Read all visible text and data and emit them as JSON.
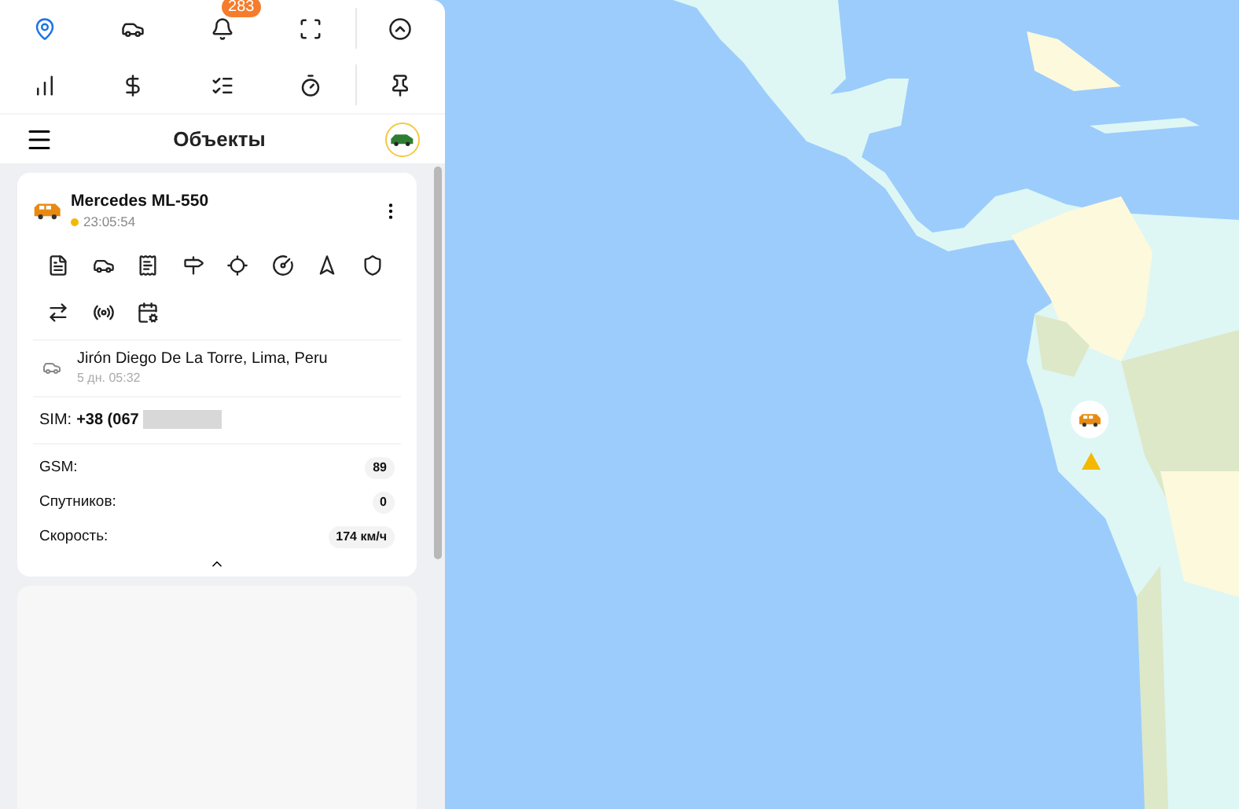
{
  "toolbar": {
    "rows": [
      [
        {
          "kind": "pin",
          "selected": true
        },
        {
          "kind": "car",
          "selected": false
        },
        {
          "kind": "bell",
          "selected": false,
          "badge": "283"
        },
        {
          "kind": "frame",
          "selected": false
        },
        {
          "kind": "collapse",
          "selected": false
        }
      ],
      [
        {
          "kind": "chart",
          "selected": false
        },
        {
          "kind": "dollar",
          "selected": false
        },
        {
          "kind": "list",
          "selected": false
        },
        {
          "kind": "clock",
          "selected": false
        },
        {
          "kind": "pushpin",
          "selected": false
        }
      ]
    ]
  },
  "header": {
    "title": "Объекты"
  },
  "object_card": {
    "name": "Mercedes ML-550",
    "time": "23:05:54",
    "actions": [
      {
        "kind": "report"
      },
      {
        "kind": "car"
      },
      {
        "kind": "receipt"
      },
      {
        "kind": "route"
      },
      {
        "kind": "locate"
      },
      {
        "kind": "gauge"
      },
      {
        "kind": "navigate"
      },
      {
        "kind": "shield"
      },
      {
        "kind": "swap"
      },
      {
        "kind": "signal"
      },
      {
        "kind": "calendar"
      }
    ],
    "address": "Jirón Diego De La Torre, Lima, Peru",
    "address_age": "5 дн. 05:32",
    "sim_label": "SIM:",
    "sim_number": "+38 (067",
    "stats": [
      {
        "label": "GSM:",
        "value": "89"
      },
      {
        "label": "Спутников:",
        "value": "0"
      },
      {
        "label": "Скорость:",
        "value": "174 км/ч"
      }
    ],
    "expanded": true
  }
}
